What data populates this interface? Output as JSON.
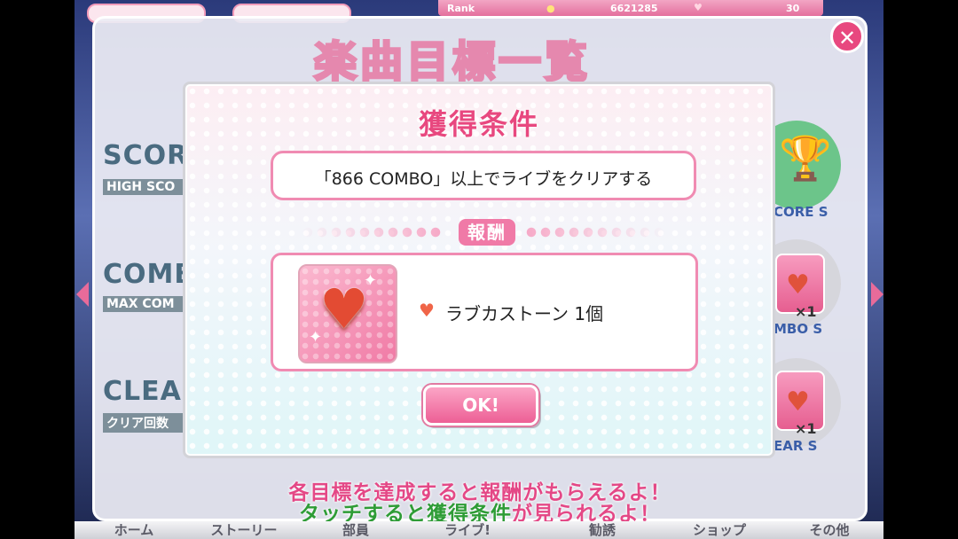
{
  "status_bar": {
    "rank_label": "Rank",
    "gold": "6621285",
    "loveca": "30"
  },
  "goals_panel": {
    "title": "楽曲目標一覧",
    "close_icon": "close-icon",
    "goals": [
      {
        "title": "SCOR",
        "subtitle": "HIGH SCO",
        "reward_label": "CORE S"
      },
      {
        "title": "COMB",
        "subtitle": "MAX COM",
        "reward_label": "MBO S",
        "reward_count": "×1"
      },
      {
        "title": "CLEAR",
        "subtitle": "クリア回数",
        "reward_label": "EAR S",
        "reward_count": "×1"
      }
    ],
    "hint_line1": "各目標を達成すると報酬がもらえるよ！",
    "hint_line2_green": "タッチすると獲得条件",
    "hint_line2_rest": "が見られるよ！"
  },
  "tab_bar": [
    "ホーム",
    "ストーリー",
    "部員",
    "ライブ!",
    "勧誘",
    "ショップ",
    "その他"
  ],
  "dialog": {
    "title": "獲得条件",
    "condition": "「866 COMBO」以上でライブをクリアする",
    "reward_header": "報酬",
    "reward_item_name": "ラブカストーン",
    "reward_item_count": "1個",
    "item_icon": "heart-icon",
    "ok_label": "OK!"
  },
  "colors": {
    "accent_pink": "#e8487f",
    "border_pink": "#f08bb2",
    "hint_green": "#2e9c36"
  }
}
